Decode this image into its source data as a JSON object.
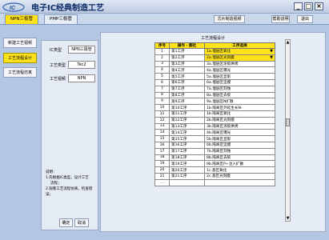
{
  "app": {
    "title": "电子IC经典制造工艺",
    "logo_text": "IC"
  },
  "window_controls": {
    "minimize": "_",
    "restore": "□",
    "close": "×"
  },
  "tabs": [
    {
      "label": "NPN三极管",
      "active": true
    },
    {
      "label": "PMP三极管",
      "active": false
    }
  ],
  "top_buttons": {
    "chip_manufacturing": "芯片制造视频",
    "help": "帮助说明",
    "exit": "退出"
  },
  "nav": [
    {
      "label": "新建工艺视频",
      "active": false
    },
    {
      "label": "工艺流程设计",
      "active": true
    },
    {
      "label": "工艺流程仿真",
      "active": false
    }
  ],
  "info": {
    "ic_type_label": "IC类型",
    "ic_type_value": "NPN三极管",
    "process_type_label": "工艺类型",
    "process_type_value": "Tec2",
    "process_model_label": "工艺视频",
    "process_model_value": "NPN"
  },
  "notes": {
    "title": "说明：",
    "line1": "1.先根据IC类型，设计工艺",
    "line1b": "流程；",
    "line2": "2.观看工艺流程仿真，检查错误；"
  },
  "buttons": {
    "confirm": "确定",
    "cancel": "取消"
  },
  "table": {
    "title": "工艺流程设计",
    "headers": [
      "序号",
      "操作 - 图社",
      "工序选择"
    ],
    "rows": [
      [
        "1",
        "第1工序",
        "1a.埋层区氧化"
      ],
      [
        "2",
        "第2工序",
        "2a.埋层区光刻膜"
      ],
      [
        "3",
        "第3工序",
        "3a.埋层区涂胶烘烤"
      ],
      [
        "4",
        "第4工序",
        "4a.埋层区曝光"
      ],
      [
        "5",
        "第5工序",
        "5a.埋层区显影"
      ],
      [
        "6",
        "第6工序",
        "6a.埋层区坚膜"
      ],
      [
        "7",
        "第7工序",
        "7a.埋层区刻蚀"
      ],
      [
        "8",
        "第8工序",
        "8a.埋层区去胶"
      ],
      [
        "9",
        "第9工序",
        "9a.埋层区N扩散"
      ],
      [
        "10",
        "第10工序",
        "1b.隔离区外延生长N-"
      ],
      [
        "11",
        "第11工序",
        "1b.隔离区氧化"
      ],
      [
        "12",
        "第12工序",
        "2b.隔离区光刻膜"
      ],
      [
        "13",
        "第13工序",
        "3b.隔离区涂胶烘烤"
      ],
      [
        "14",
        "第14工序",
        "4b.隔离区曝光"
      ],
      [
        "15",
        "第15工序",
        "5b.隔离区显影"
      ],
      [
        "16",
        "第16工序",
        "6b.隔离区坚膜"
      ],
      [
        "17",
        "第17工序",
        "7b.隔离区刻蚀"
      ],
      [
        "18",
        "第18工序",
        "8b.隔离区去胶"
      ],
      [
        "19",
        "第19工序",
        "9b.隔离区P+注入扩散"
      ],
      [
        "20",
        "第20工序",
        "1c.基区氧化"
      ],
      [
        "21",
        "第21工序",
        "2c.基区光刻膜"
      ],
      [
        "...",
        "",
        ""
      ]
    ],
    "dropdown_rows": [
      "1",
      "2"
    ]
  },
  "colors": {
    "accent": "#ffe31a",
    "background": "#b4c7e2",
    "title": "#0b2a66"
  }
}
